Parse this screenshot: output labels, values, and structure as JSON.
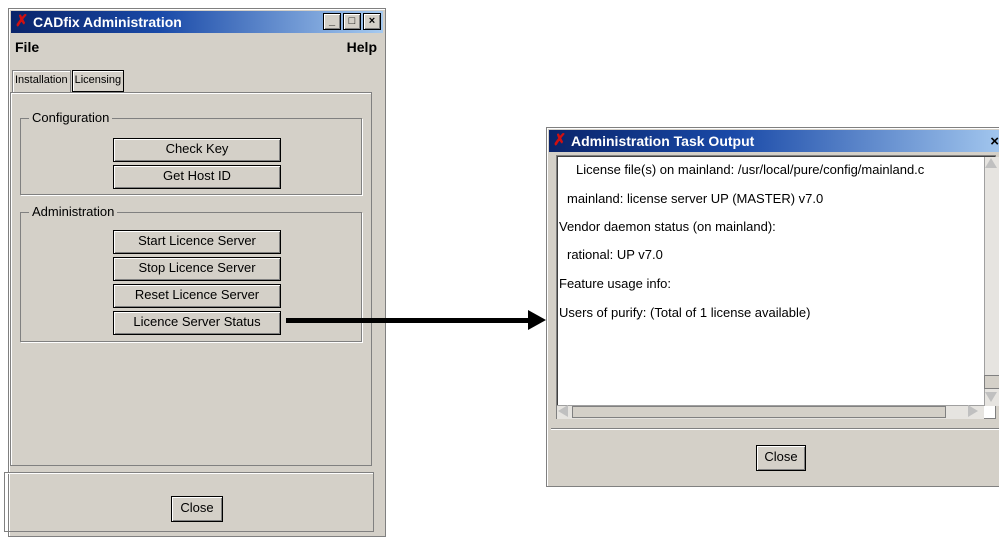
{
  "admin_window": {
    "title": "CADfix Administration",
    "title_buttons": [
      "_",
      "□",
      "×"
    ],
    "menu": {
      "file": "File",
      "help": "Help"
    },
    "tabs": [
      {
        "label": "Installation",
        "active": false
      },
      {
        "label": "Licensing",
        "active": true
      }
    ],
    "configuration": {
      "label": "Configuration",
      "buttons": [
        "Check Key",
        "Get Host ID"
      ]
    },
    "administration": {
      "label": "Administration",
      "buttons": [
        "Start Licence Server",
        "Stop Licence Server",
        "Reset Licence Server",
        "Licence Server Status"
      ]
    },
    "close_label": "Close"
  },
  "output_window": {
    "title": "Administration Task Output",
    "close_icon": "×",
    "lines": [
      "License file(s) on mainland: /usr/local/pure/config/mainland.c",
      "mainland: license server UP (MASTER) v7.0",
      "Vendor daemon status (on mainland):",
      "rational: UP v7.0",
      "Feature usage info:",
      "Users of purify:  (Total of 1 license available)"
    ],
    "close_label": "Close"
  },
  "icons": {
    "app_icon": "x-mark-icon",
    "arrow": "arrow-right-icon"
  },
  "colors": {
    "titlebar_start": "#0a246a",
    "titlebar_end": "#a6caf0",
    "window_bg": "#d4d0c8"
  }
}
